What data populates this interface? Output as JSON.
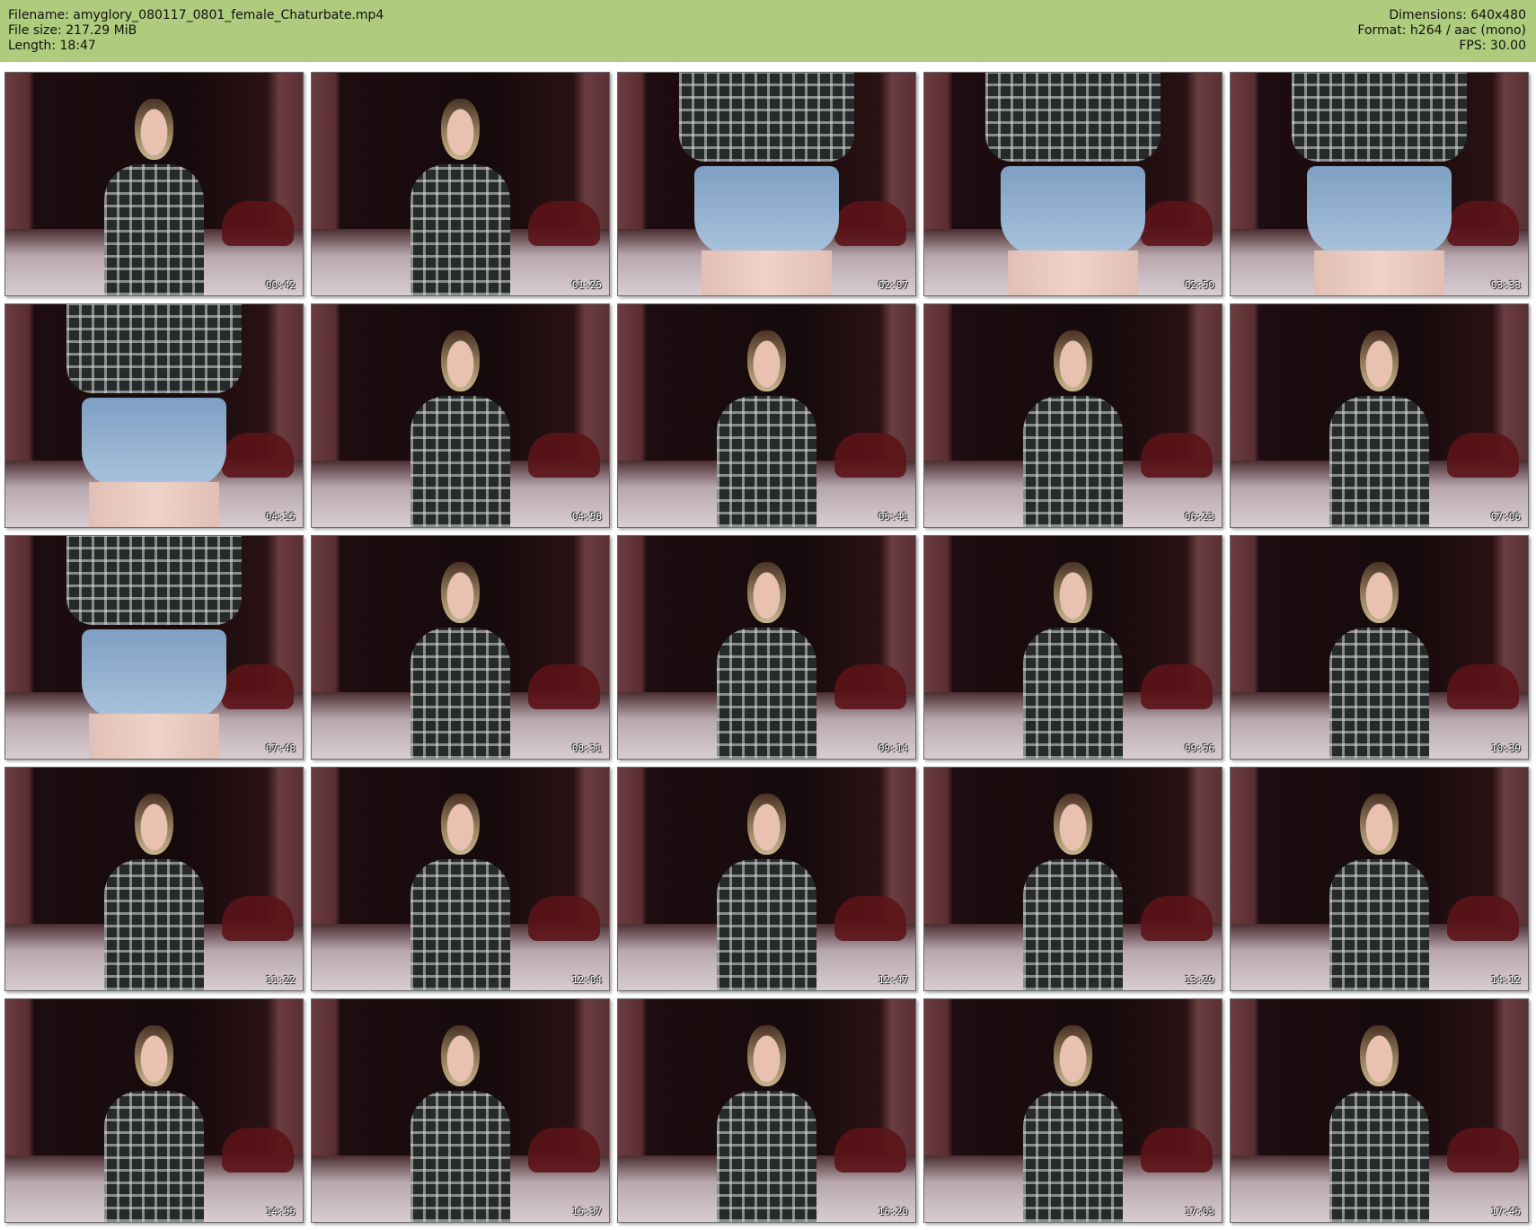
{
  "header": {
    "filename_line": "Filename: amyglory_080117_0801_female_Chaturbate.mp4",
    "filesize_line": "File size: 217.29 MiB",
    "length_line": "Length: 18:47",
    "dimensions_line": "Dimensions: 640x480",
    "format_line": "Format: h264 / aac (mono)",
    "fps_line": "FPS: 30.00"
  },
  "colors": {
    "header_background": "#aecb7e",
    "page_background": "#ffffff"
  },
  "thumbnails": [
    {
      "time": "00:42",
      "shot": "medium"
    },
    {
      "time": "01:25",
      "shot": "medium"
    },
    {
      "time": "02:07",
      "shot": "closeup"
    },
    {
      "time": "02:50",
      "shot": "closeup"
    },
    {
      "time": "03:33",
      "shot": "closeup"
    },
    {
      "time": "04:15",
      "shot": "closeup"
    },
    {
      "time": "04:58",
      "shot": "medium"
    },
    {
      "time": "05:41",
      "shot": "medium"
    },
    {
      "time": "06:23",
      "shot": "medium"
    },
    {
      "time": "07:06",
      "shot": "medium"
    },
    {
      "time": "07:48",
      "shot": "closeup"
    },
    {
      "time": "08:31",
      "shot": "medium"
    },
    {
      "time": "09:14",
      "shot": "medium"
    },
    {
      "time": "09:56",
      "shot": "medium"
    },
    {
      "time": "10:39",
      "shot": "medium"
    },
    {
      "time": "11:22",
      "shot": "medium"
    },
    {
      "time": "12:04",
      "shot": "medium"
    },
    {
      "time": "12:47",
      "shot": "medium"
    },
    {
      "time": "13:29",
      "shot": "medium"
    },
    {
      "time": "14:12",
      "shot": "medium"
    },
    {
      "time": "14:55",
      "shot": "medium"
    },
    {
      "time": "15:37",
      "shot": "medium"
    },
    {
      "time": "16:20",
      "shot": "medium"
    },
    {
      "time": "17:03",
      "shot": "medium"
    },
    {
      "time": "17:45",
      "shot": "medium"
    }
  ]
}
